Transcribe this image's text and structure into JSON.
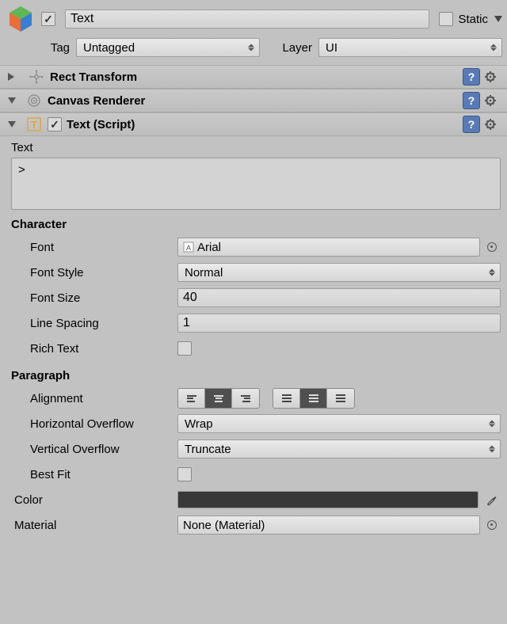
{
  "header": {
    "active": true,
    "name": "Text",
    "static_label": "Static",
    "static": false,
    "tag_label": "Tag",
    "tag_value": "Untagged",
    "layer_label": "Layer",
    "layer_value": "UI"
  },
  "components": {
    "rect": {
      "title": "Rect Transform",
      "expanded": false
    },
    "canvas": {
      "title": "Canvas Renderer",
      "expanded": true
    },
    "text": {
      "title": "Text (Script)",
      "enabled": true,
      "expanded": true,
      "text_label": "Text",
      "text_value": ">",
      "section_char": "Character",
      "font_label": "Font",
      "font_value": "Arial",
      "font_style_label": "Font Style",
      "font_style_value": "Normal",
      "font_size_label": "Font Size",
      "font_size_value": "40",
      "line_spacing_label": "Line Spacing",
      "line_spacing_value": "1",
      "rich_text_label": "Rich Text",
      "rich_text_value": false,
      "section_para": "Paragraph",
      "alignment_label": "Alignment",
      "h_overflow_label": "Horizontal Overflow",
      "h_overflow_value": "Wrap",
      "v_overflow_label": "Vertical Overflow",
      "v_overflow_value": "Truncate",
      "best_fit_label": "Best Fit",
      "best_fit_value": false,
      "color_label": "Color",
      "color_value": "#383838",
      "material_label": "Material",
      "material_value": "None (Material)"
    }
  }
}
